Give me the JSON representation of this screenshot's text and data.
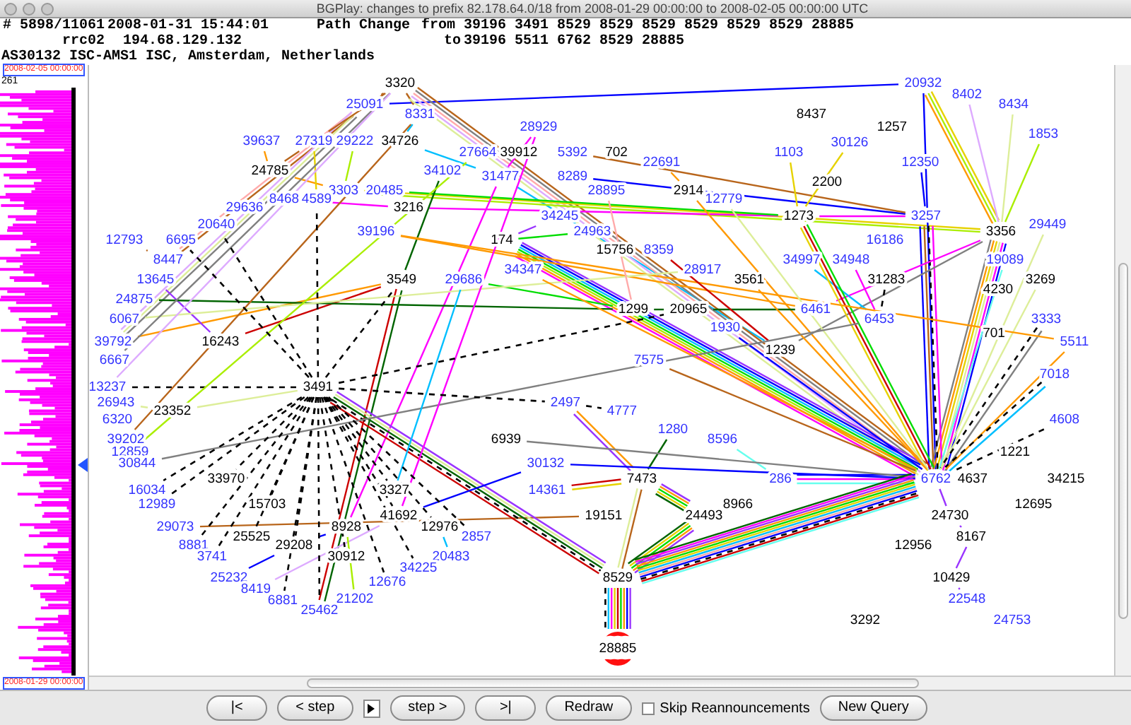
{
  "window": {
    "title": "BGPlay: changes to prefix 82.178.64.0/18 from 2008-01-29 00:00:00 to 2008-02-05 00:00:00 UTC"
  },
  "header": {
    "event": "# 5898/11061",
    "timestamp": "2008-01-31 15:44:01",
    "event_type": "Path Change",
    "from_label": "from",
    "from_path": "39196 3491 8529 8529 8529 8529 8529 8529 28885",
    "collector": "rrc02",
    "peer_ip": "194.68.129.132",
    "to_label": "to",
    "to_path": "39196 5511 6762 8529 28885",
    "origin": "AS30132 ISC-AMS1 ISC, Amsterdam, Netherlands"
  },
  "timeline": {
    "end": "2008-02-05 00:00:00",
    "max_count": "261",
    "start": "2008-01-29 00:00:00",
    "level": 0.38
  },
  "graph": {
    "nodes": [
      {
        "label": "3320",
        "color": "#000000",
        "kind": "as"
      },
      {
        "label": "20932",
        "color": "#3333ff",
        "kind": "as"
      },
      {
        "label": "8402",
        "color": "#3333ff",
        "kind": "as"
      },
      {
        "label": "25091",
        "color": "#3333ff",
        "kind": "as"
      },
      {
        "label": "8434",
        "color": "#3333ff",
        "kind": "as"
      },
      {
        "label": "8331",
        "color": "#3333ff",
        "kind": "as"
      },
      {
        "label": "8437",
        "color": "#000000",
        "kind": "as"
      },
      {
        "label": "28929",
        "color": "#3333ff",
        "kind": "as"
      },
      {
        "label": "1257",
        "color": "#000000",
        "kind": "as"
      },
      {
        "label": "1853",
        "color": "#3333ff",
        "kind": "as"
      },
      {
        "label": "39637",
        "color": "#3333ff",
        "kind": "as"
      },
      {
        "label": "27319",
        "color": "#3333ff",
        "kind": "as"
      },
      {
        "label": "29222",
        "color": "#3333ff",
        "kind": "as"
      },
      {
        "label": "34726",
        "color": "#000000",
        "kind": "as"
      },
      {
        "label": "30126",
        "color": "#3333ff",
        "kind": "as"
      },
      {
        "label": "27664",
        "color": "#3333ff",
        "kind": "as"
      },
      {
        "label": "39912",
        "color": "#000000",
        "kind": "as"
      },
      {
        "label": "5392",
        "color": "#3333ff",
        "kind": "as"
      },
      {
        "label": "702",
        "color": "#000000",
        "kind": "as"
      },
      {
        "label": "1103",
        "color": "#3333ff",
        "kind": "as"
      },
      {
        "label": "22691",
        "color": "#3333ff",
        "kind": "as"
      },
      {
        "label": "12350",
        "color": "#3333ff",
        "kind": "as"
      },
      {
        "label": "24785",
        "color": "#000000",
        "kind": "as"
      },
      {
        "label": "34102",
        "color": "#3333ff",
        "kind": "as"
      },
      {
        "label": "31477",
        "color": "#3333ff",
        "kind": "as"
      },
      {
        "label": "8289",
        "color": "#3333ff",
        "kind": "as"
      },
      {
        "label": "2200",
        "color": "#000000",
        "kind": "as"
      },
      {
        "label": "3303",
        "color": "#3333ff",
        "kind": "as"
      },
      {
        "label": "20485",
        "color": "#3333ff",
        "kind": "as"
      },
      {
        "label": "28895",
        "color": "#3333ff",
        "kind": "as"
      },
      {
        "label": "2914",
        "color": "#000000",
        "kind": "as"
      },
      {
        "label": "8468",
        "color": "#3333ff",
        "kind": "as"
      },
      {
        "label": "4589",
        "color": "#3333ff",
        "kind": "as"
      },
      {
        "label": "12779",
        "color": "#3333ff",
        "kind": "as"
      },
      {
        "label": "29636",
        "color": "#3333ff",
        "kind": "as"
      },
      {
        "label": "3216",
        "color": "#000000",
        "kind": "as"
      },
      {
        "label": "34245",
        "color": "#3333ff",
        "kind": "as"
      },
      {
        "label": "1273",
        "color": "#000000",
        "kind": "as"
      },
      {
        "label": "3257",
        "color": "#3333ff",
        "kind": "as"
      },
      {
        "label": "20640",
        "color": "#3333ff",
        "kind": "as"
      },
      {
        "label": "29449",
        "color": "#3333ff",
        "kind": "as"
      },
      {
        "label": "39196",
        "color": "#3333ff",
        "kind": "as"
      },
      {
        "label": "24963",
        "color": "#3333ff",
        "kind": "as"
      },
      {
        "label": "3356",
        "color": "#000000",
        "kind": "as"
      },
      {
        "label": "12793",
        "color": "#3333ff",
        "kind": "as"
      },
      {
        "label": "6695",
        "color": "#3333ff",
        "kind": "as"
      },
      {
        "label": "174",
        "color": "#000000",
        "kind": "as"
      },
      {
        "label": "16186",
        "color": "#3333ff",
        "kind": "as"
      },
      {
        "label": "15756",
        "color": "#000000",
        "kind": "as"
      },
      {
        "label": "8359",
        "color": "#3333ff",
        "kind": "as"
      },
      {
        "label": "8447",
        "color": "#3333ff",
        "kind": "as"
      },
      {
        "label": "34997",
        "color": "#3333ff",
        "kind": "as"
      },
      {
        "label": "34948",
        "color": "#3333ff",
        "kind": "as"
      },
      {
        "label": "19089",
        "color": "#3333ff",
        "kind": "as"
      },
      {
        "label": "34347",
        "color": "#3333ff",
        "kind": "as"
      },
      {
        "label": "28917",
        "color": "#3333ff",
        "kind": "as"
      },
      {
        "label": "13645",
        "color": "#3333ff",
        "kind": "as"
      },
      {
        "label": "3549",
        "color": "#000000",
        "kind": "as"
      },
      {
        "label": "29686",
        "color": "#3333ff",
        "kind": "as"
      },
      {
        "label": "3561",
        "color": "#000000",
        "kind": "as"
      },
      {
        "label": "31283",
        "color": "#000000",
        "kind": "as"
      },
      {
        "label": "3269",
        "color": "#000000",
        "kind": "as"
      },
      {
        "label": "4230",
        "color": "#000000",
        "kind": "as"
      },
      {
        "label": "24875",
        "color": "#3333ff",
        "kind": "as"
      },
      {
        "label": "1299",
        "color": "#000000",
        "kind": "as"
      },
      {
        "label": "20965",
        "color": "#000000",
        "kind": "as"
      },
      {
        "label": "6461",
        "color": "#3333ff",
        "kind": "as"
      },
      {
        "label": "6067",
        "color": "#3333ff",
        "kind": "as"
      },
      {
        "label": "6453",
        "color": "#3333ff",
        "kind": "as"
      },
      {
        "label": "3333",
        "color": "#3333ff",
        "kind": "as"
      },
      {
        "label": "1930",
        "color": "#3333ff",
        "kind": "as"
      },
      {
        "label": "701",
        "color": "#000000",
        "kind": "as"
      },
      {
        "label": "39792",
        "color": "#3333ff",
        "kind": "as"
      },
      {
        "label": "16243",
        "color": "#000000",
        "kind": "as"
      },
      {
        "label": "5511",
        "color": "#3333ff",
        "kind": "as"
      },
      {
        "label": "1239",
        "color": "#000000",
        "kind": "as"
      },
      {
        "label": "6667",
        "color": "#3333ff",
        "kind": "as"
      },
      {
        "label": "7575",
        "color": "#3333ff",
        "kind": "as"
      },
      {
        "label": "7018",
        "color": "#3333ff",
        "kind": "as"
      },
      {
        "label": "13237",
        "color": "#3333ff",
        "kind": "as"
      },
      {
        "label": "3491",
        "color": "#000000",
        "kind": "as"
      },
      {
        "label": "26943",
        "color": "#3333ff",
        "kind": "as"
      },
      {
        "label": "2497",
        "color": "#3333ff",
        "kind": "as"
      },
      {
        "label": "23352",
        "color": "#000000",
        "kind": "as"
      },
      {
        "label": "4777",
        "color": "#3333ff",
        "kind": "as"
      },
      {
        "label": "6320",
        "color": "#3333ff",
        "kind": "as"
      },
      {
        "label": "4608",
        "color": "#3333ff",
        "kind": "as"
      },
      {
        "label": "1280",
        "color": "#3333ff",
        "kind": "as"
      },
      {
        "label": "39202",
        "color": "#3333ff",
        "kind": "as"
      },
      {
        "label": "6939",
        "color": "#000000",
        "kind": "as"
      },
      {
        "label": "8596",
        "color": "#3333ff",
        "kind": "as"
      },
      {
        "label": "12859",
        "color": "#3333ff",
        "kind": "as"
      },
      {
        "label": "1221",
        "color": "#000000",
        "kind": "as"
      },
      {
        "label": "30844",
        "color": "#3333ff",
        "kind": "as"
      },
      {
        "label": "30132",
        "color": "#3333ff",
        "kind": "as"
      },
      {
        "label": "33970",
        "color": "#000000",
        "kind": "as"
      },
      {
        "label": "7473",
        "color": "#000000",
        "kind": "as"
      },
      {
        "label": "286",
        "color": "#3333ff",
        "kind": "as"
      },
      {
        "label": "6762",
        "color": "#3333ff",
        "kind": "as"
      },
      {
        "label": "4637",
        "color": "#000000",
        "kind": "as"
      },
      {
        "label": "34215",
        "color": "#000000",
        "kind": "as"
      },
      {
        "label": "16034",
        "color": "#3333ff",
        "kind": "as"
      },
      {
        "label": "3327",
        "color": "#000000",
        "kind": "as"
      },
      {
        "label": "14361",
        "color": "#3333ff",
        "kind": "as"
      },
      {
        "label": "12989",
        "color": "#3333ff",
        "kind": "as"
      },
      {
        "label": "15703",
        "color": "#000000",
        "kind": "as"
      },
      {
        "label": "8966",
        "color": "#000000",
        "kind": "as"
      },
      {
        "label": "12695",
        "color": "#000000",
        "kind": "as"
      },
      {
        "label": "41692",
        "color": "#000000",
        "kind": "as"
      },
      {
        "label": "19151",
        "color": "#000000",
        "kind": "as"
      },
      {
        "label": "24493",
        "color": "#000000",
        "kind": "as"
      },
      {
        "label": "24730",
        "color": "#000000",
        "kind": "as"
      },
      {
        "label": "29073",
        "color": "#3333ff",
        "kind": "as"
      },
      {
        "label": "8928",
        "color": "#000000",
        "kind": "as"
      },
      {
        "label": "12976",
        "color": "#000000",
        "kind": "as"
      },
      {
        "label": "25525",
        "color": "#000000",
        "kind": "as"
      },
      {
        "label": "2857",
        "color": "#3333ff",
        "kind": "as"
      },
      {
        "label": "8167",
        "color": "#000000",
        "kind": "as"
      },
      {
        "label": "8881",
        "color": "#3333ff",
        "kind": "as"
      },
      {
        "label": "29208",
        "color": "#000000",
        "kind": "as"
      },
      {
        "label": "12956",
        "color": "#000000",
        "kind": "as"
      },
      {
        "label": "3741",
        "color": "#3333ff",
        "kind": "as"
      },
      {
        "label": "30912",
        "color": "#000000",
        "kind": "as"
      },
      {
        "label": "20483",
        "color": "#3333ff",
        "kind": "as"
      },
      {
        "label": "34225",
        "color": "#3333ff",
        "kind": "as"
      },
      {
        "label": "25232",
        "color": "#3333ff",
        "kind": "as"
      },
      {
        "label": "12676",
        "color": "#3333ff",
        "kind": "as"
      },
      {
        "label": "8529",
        "color": "#000000",
        "kind": "as"
      },
      {
        "label": "10429",
        "color": "#000000",
        "kind": "as"
      },
      {
        "label": "8419",
        "color": "#3333ff",
        "kind": "as"
      },
      {
        "label": "6881",
        "color": "#3333ff",
        "kind": "as"
      },
      {
        "label": "21202",
        "color": "#3333ff",
        "kind": "as"
      },
      {
        "label": "22548",
        "color": "#3333ff",
        "kind": "as"
      },
      {
        "label": "25462",
        "color": "#3333ff",
        "kind": "as"
      },
      {
        "label": "3292",
        "color": "#000000",
        "kind": "as"
      },
      {
        "label": "24753",
        "color": "#3333ff",
        "kind": "as"
      },
      {
        "label": "28885",
        "color": "#ff1010",
        "kind": "origin"
      }
    ]
  },
  "controls": {
    "first": "|<",
    "step_back": "< step",
    "step_forward": "step >",
    "last": ">|",
    "redraw": "Redraw",
    "skip_label": "Skip Reannouncements",
    "skip_checked": false,
    "new_query": "New Query"
  }
}
